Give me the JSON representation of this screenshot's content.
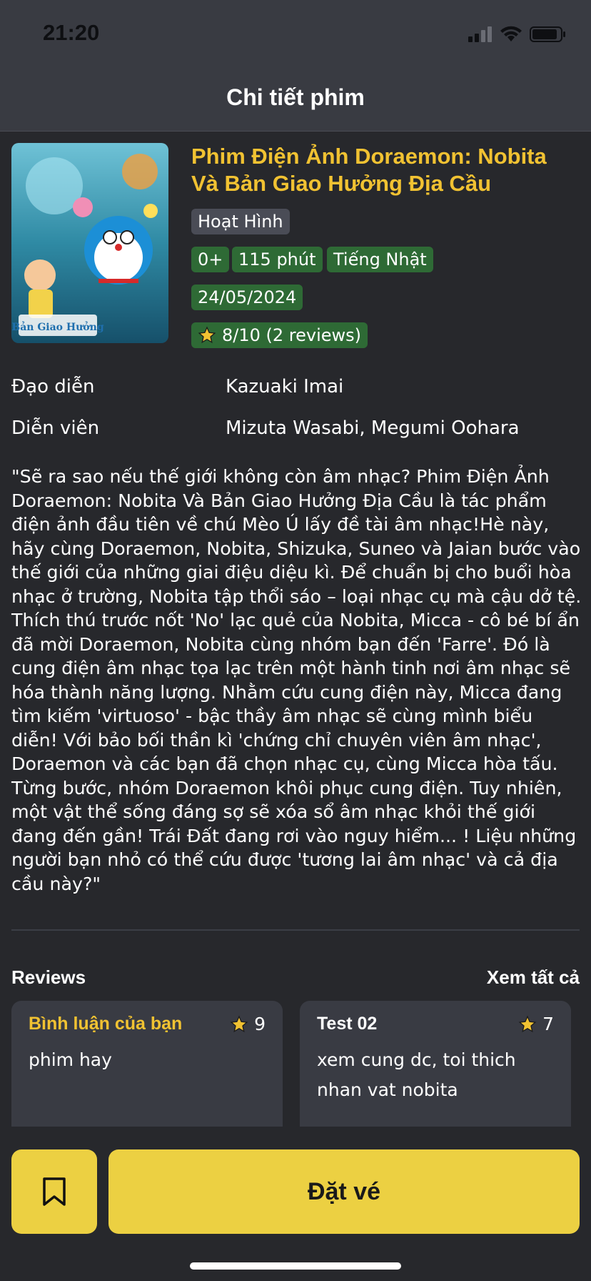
{
  "status_bar": {
    "time": "21:20"
  },
  "header": {
    "title": "Chi tiết phim"
  },
  "movie": {
    "title": "Phim Điện Ảnh Doraemon: Nobita Và Bản Giao Hưởng Địa Cầu",
    "genre": "Hoạt Hình",
    "age_rating": "0+",
    "duration": "115 phút",
    "language": "Tiếng Nhật",
    "release_date": "24/05/2024",
    "rating": "8/10 (2 reviews)",
    "poster_logo_text": "Bản Giao Hưởng",
    "director_label": "Đạo diễn",
    "director": "Kazuaki Imai",
    "cast_label": "Diễn viên",
    "cast": "Mizuta Wasabi, Megumi Oohara",
    "synopsis": "\"Sẽ ra sao nếu thế giới không còn âm nhạc? Phim Điện Ảnh Doraemon: Nobita Và Bản Giao Hưởng Địa Cầu là tác phẩm điện ảnh đầu tiên về chú Mèo Ú lấy đề tài âm nhạc!Hè này, hãy cùng Doraemon, Nobita, Shizuka, Suneo và Jaian bước vào thế giới của những giai điệu diệu kì. Để chuẩn bị cho buổi hòa nhạc ở trường, Nobita tập thổi sáo – loại nhạc cụ mà cậu dở tệ. Thích thú trước nốt 'No' lạc quẻ của Nobita, Micca - cô bé bí ẩn đã mời Doraemon, Nobita cùng nhóm bạn đến 'Farre'. Đó là cung điện âm nhạc tọa lạc trên một hành tinh nơi âm nhạc sẽ hóa thành năng lượng. Nhằm cứu cung điện này, Micca đang tìm kiếm 'virtuoso' - bậc thầy âm nhạc sẽ cùng mình biểu diễn! Với bảo bối thần kì 'chứng chỉ chuyên viên âm nhạc', Doraemon và các bạn đã chọn nhạc cụ, cùng Micca hòa tấu. Từng bước, nhóm Doraemon khôi phục cung điện. Tuy nhiên, một vật thể sống đáng sợ sẽ xóa sổ âm nhạc khỏi thế giới đang đến gần! Trái Đất đang rơi vào nguy hiểm... ! Liệu những người bạn nhỏ có thể cứu được 'tương lai âm nhạc' và cả địa cầu này?\""
  },
  "reviews": {
    "title": "Reviews",
    "see_all": "Xem tất cả",
    "items": [
      {
        "author": "Bình luận của bạn",
        "score": "9",
        "text": "phim hay",
        "author_color": "#f1c232"
      },
      {
        "author": "Test 02",
        "score": "7",
        "text": "xem cung dc, toi thich nhan vat nobita",
        "author_color": "#ffffff"
      }
    ]
  },
  "actions": {
    "book_label": "Đặt vé",
    "bookmark_icon": "bookmark-icon"
  },
  "colors": {
    "accent": "#f1c232",
    "button": "#ecd042",
    "chip_green": "#2e6a35",
    "background": "#27282c"
  }
}
